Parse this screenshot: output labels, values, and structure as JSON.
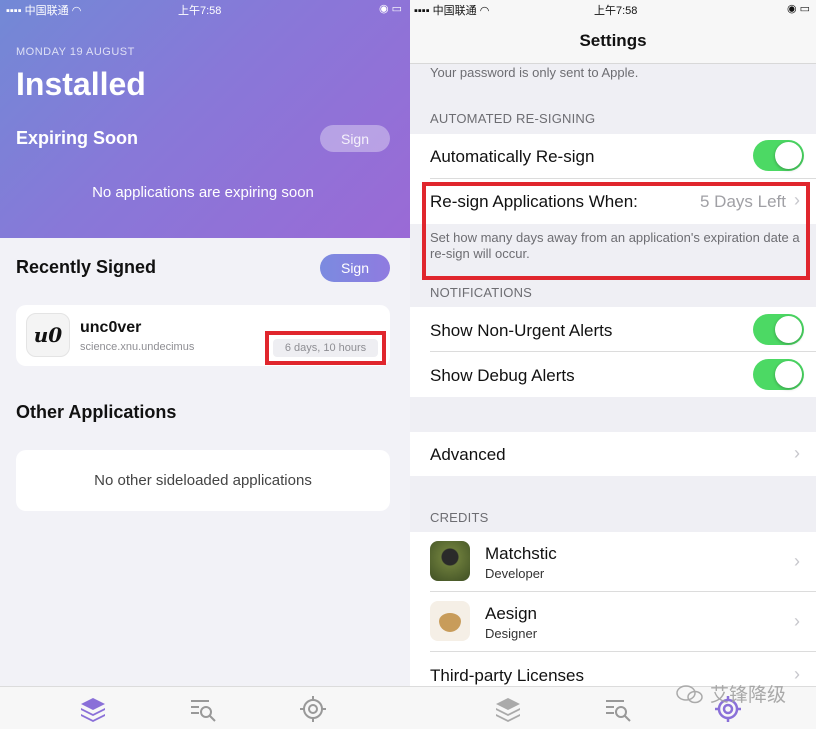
{
  "left": {
    "status": {
      "carrier": "中国联通",
      "time": "上午7:58"
    },
    "date": "MONDAY 19 AUGUST",
    "title": "Installed",
    "expiring": {
      "title": "Expiring Soon",
      "sign_label": "Sign",
      "empty_text": "No applications are expiring soon"
    },
    "recent": {
      "title": "Recently Signed",
      "sign_label": "Sign",
      "app": {
        "icon_text": "u0",
        "name": "unc0ver",
        "bundle": "science.xnu.undecimus",
        "expires": "6 days, 10 hours"
      }
    },
    "other": {
      "title": "Other Applications",
      "empty_text": "No other sideloaded applications"
    },
    "tabs": [
      {
        "icon": "stack-icon",
        "active": true
      },
      {
        "icon": "browse-search-icon",
        "active": false
      },
      {
        "icon": "settings-gear-icon",
        "active": false
      }
    ]
  },
  "right": {
    "status": {
      "carrier": "中国联通",
      "time": "上午7:58"
    },
    "nav_title": "Settings",
    "password_note": "Your password is only sent to Apple.",
    "resign_section": {
      "header": "AUTOMATED RE-SIGNING",
      "auto_resign_label": "Automatically Re-sign",
      "auto_resign_on": true,
      "when_label": "Re-sign Applications When:",
      "when_value": "5 Days Left",
      "description": "Set how many days away from an application's expiration date a re-sign will occur."
    },
    "notifications": {
      "header": "NOTIFICATIONS",
      "non_urgent_label": "Show Non-Urgent Alerts",
      "non_urgent_on": true,
      "debug_label": "Show Debug Alerts",
      "debug_on": true
    },
    "advanced_label": "Advanced",
    "credits": {
      "header": "CREDITS",
      "people": [
        {
          "name": "Matchstic",
          "role": "Developer"
        },
        {
          "name": "Aesign",
          "role": "Designer"
        }
      ],
      "licenses_label": "Third-party Licenses"
    },
    "watermark": "艾锋降级"
  },
  "colors": {
    "accent": "#8a7ce0",
    "toggle_on": "#4cd964",
    "highlight": "#e0262d"
  }
}
